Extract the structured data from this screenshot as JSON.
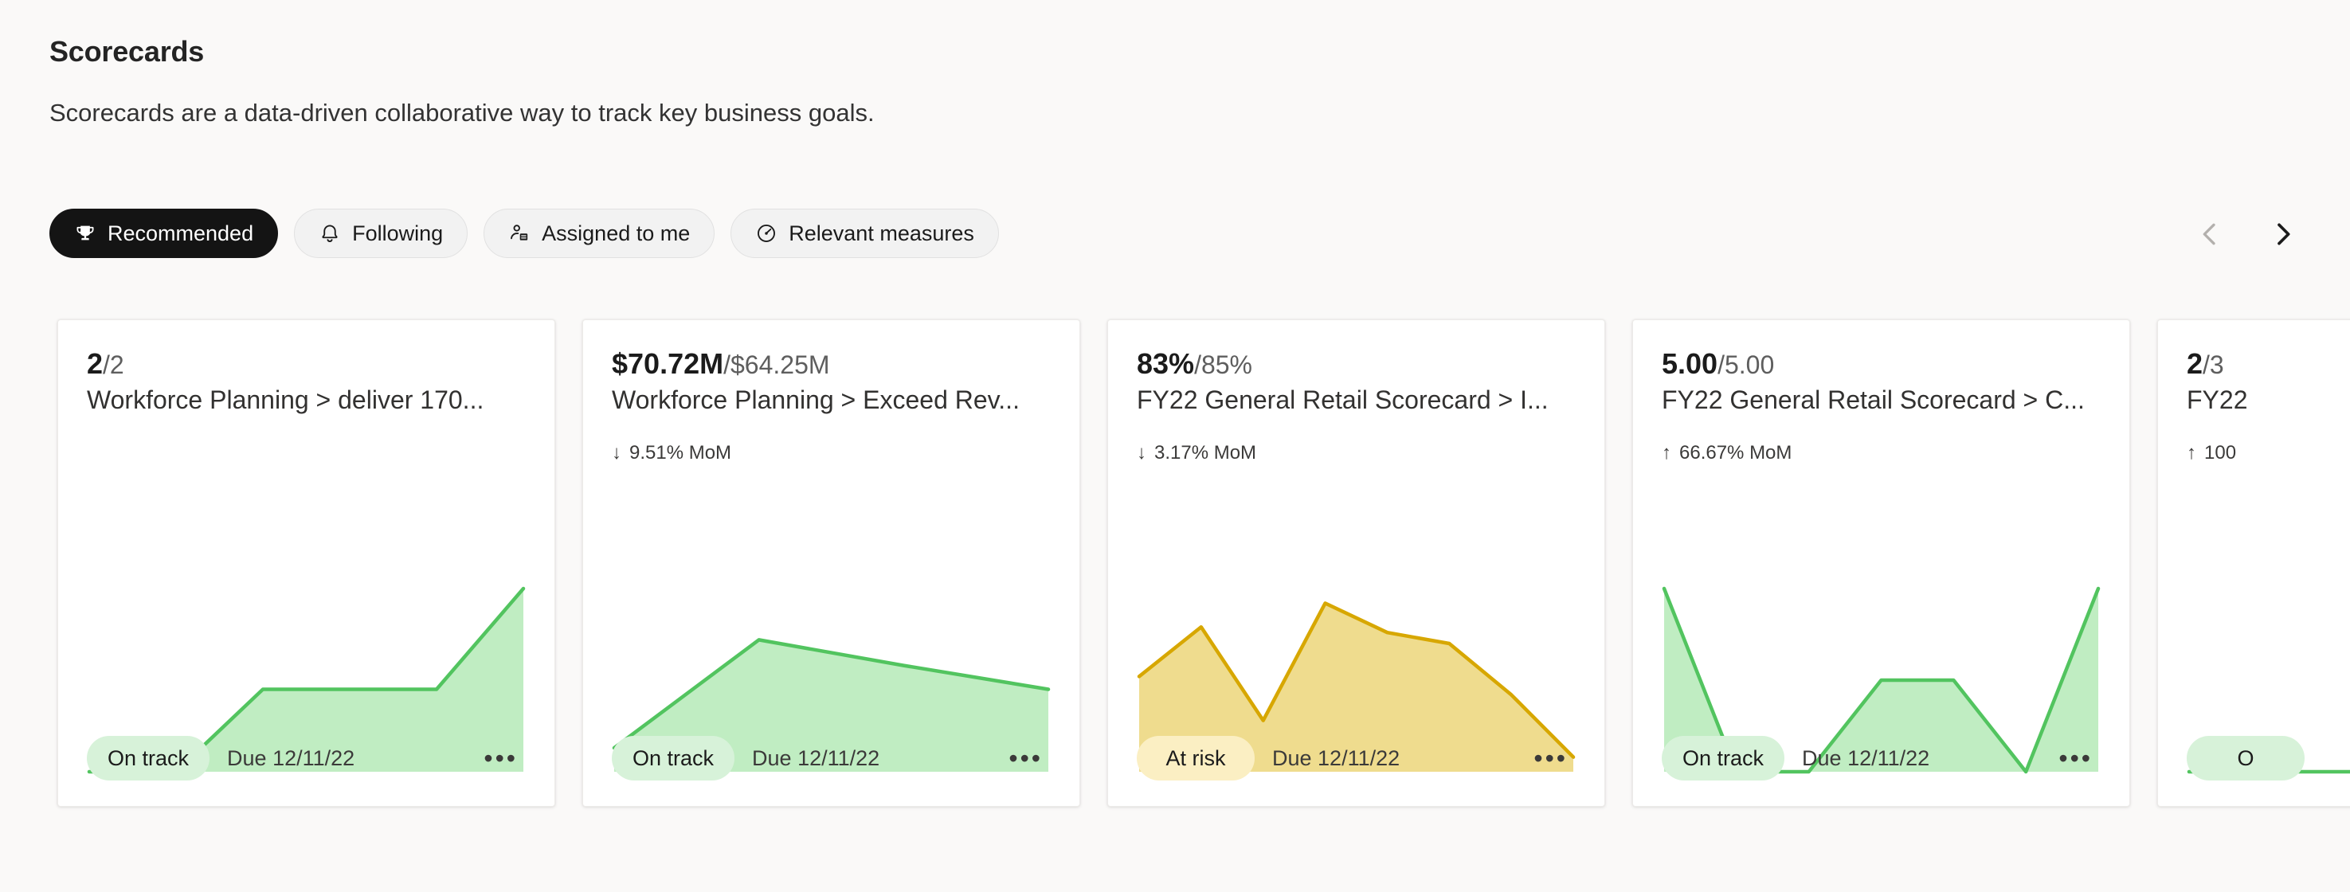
{
  "header": {
    "title": "Scorecards",
    "subtitle": "Scorecards are a data-driven collaborative way to track key business goals."
  },
  "filters": {
    "items": [
      {
        "label": "Recommended",
        "icon": "trophy-icon",
        "selected": true
      },
      {
        "label": "Following",
        "icon": "bell-icon",
        "selected": false
      },
      {
        "label": "Assigned to me",
        "icon": "person-card-icon",
        "selected": false
      },
      {
        "label": "Relevant measures",
        "icon": "gauge-icon",
        "selected": false
      }
    ]
  },
  "pager": {
    "prev_label": "‹",
    "next_label": "›",
    "prev_enabled": false,
    "next_enabled": true
  },
  "colors": {
    "on_track_stroke": "#52C45F",
    "on_track_fill": "#C0EDC2",
    "on_track_badge_bg": "#D7F2D9",
    "at_risk_stroke": "#D7A700",
    "at_risk_fill": "#EFDC8E",
    "at_risk_badge_bg": "#FBEFC3",
    "selected_pill_bg": "#141414",
    "page_bg": "#FAF9F8"
  },
  "cards": [
    {
      "current": "2",
      "target": "/2",
      "name": "Workforce Planning > deliver 170...",
      "trend_arrow": "",
      "trend_text": "",
      "status": "On track",
      "status_kind": "ontrack",
      "due": "Due 12/11/22",
      "more_label": "•••",
      "chart_data": {
        "type": "area",
        "title": "Workforce Planning > deliver 170...",
        "stroke": "#52C45F",
        "fill": "#C0EDC2",
        "x": [
          0,
          1,
          2,
          3,
          4,
          5
        ],
        "values": [
          0,
          0,
          45,
          45,
          45,
          100
        ],
        "ylim": [
          0,
          100
        ],
        "grid": false,
        "legend": "none"
      }
    },
    {
      "current": "$70.72M",
      "target": "/$64.25M",
      "name": "Workforce Planning > Exceed Rev...",
      "trend_arrow": "↓",
      "trend_text": "9.51% MoM",
      "status": "On track",
      "status_kind": "ontrack",
      "due": "Due 12/11/22",
      "more_label": "•••",
      "chart_data": {
        "type": "area",
        "title": "Workforce Planning > Exceed Rev...",
        "stroke": "#52C45F",
        "fill": "#C0EDC2",
        "x": [
          0,
          1,
          2,
          3
        ],
        "values": [
          13,
          72,
          58,
          45
        ],
        "ylim": [
          0,
          100
        ],
        "grid": false,
        "legend": "none"
      }
    },
    {
      "current": "83%",
      "target": "/85%",
      "name": "FY22 General Retail Scorecard > I...",
      "trend_arrow": "↓",
      "trend_text": "3.17% MoM",
      "status": "At risk",
      "status_kind": "atrisk",
      "due": "Due 12/11/22",
      "more_label": "•••",
      "chart_data": {
        "type": "area",
        "title": "FY22 General Retail Scorecard > I...",
        "stroke": "#D7A700",
        "fill": "#EFDC8E",
        "x": [
          0,
          1,
          2,
          3,
          4,
          5,
          6,
          7
        ],
        "values": [
          52,
          79,
          28,
          92,
          76,
          70,
          42,
          8
        ],
        "ylim": [
          0,
          100
        ],
        "grid": false,
        "legend": "none"
      }
    },
    {
      "current": "5.00",
      "target": "/5.00",
      "name": "FY22 General Retail Scorecard > C...",
      "trend_arrow": "↑",
      "trend_text": "66.67% MoM",
      "status": "On track",
      "status_kind": "ontrack",
      "due": "Due 12/11/22",
      "more_label": "•••",
      "chart_data": {
        "type": "area",
        "title": "FY22 General Retail Scorecard > C...",
        "stroke": "#52C45F",
        "fill": "#C0EDC2",
        "x": [
          0,
          1,
          2,
          3,
          4,
          5,
          6
        ],
        "values": [
          100,
          0,
          0,
          50,
          50,
          0,
          100
        ],
        "ylim": [
          0,
          100
        ],
        "grid": false,
        "legend": "none"
      }
    },
    {
      "current": "2",
      "target": "/3",
      "name": "FY22",
      "trend_arrow": "↑",
      "trend_text": "100",
      "status": "O",
      "status_kind": "ontrack",
      "due": "",
      "more_label": "",
      "chart_data": {
        "type": "area",
        "title": "FY22",
        "stroke": "#52C45F",
        "fill": "#C0EDC2",
        "x": [
          0,
          1
        ],
        "values": [
          0,
          0
        ],
        "ylim": [
          0,
          100
        ],
        "grid": false,
        "legend": "none"
      }
    }
  ]
}
